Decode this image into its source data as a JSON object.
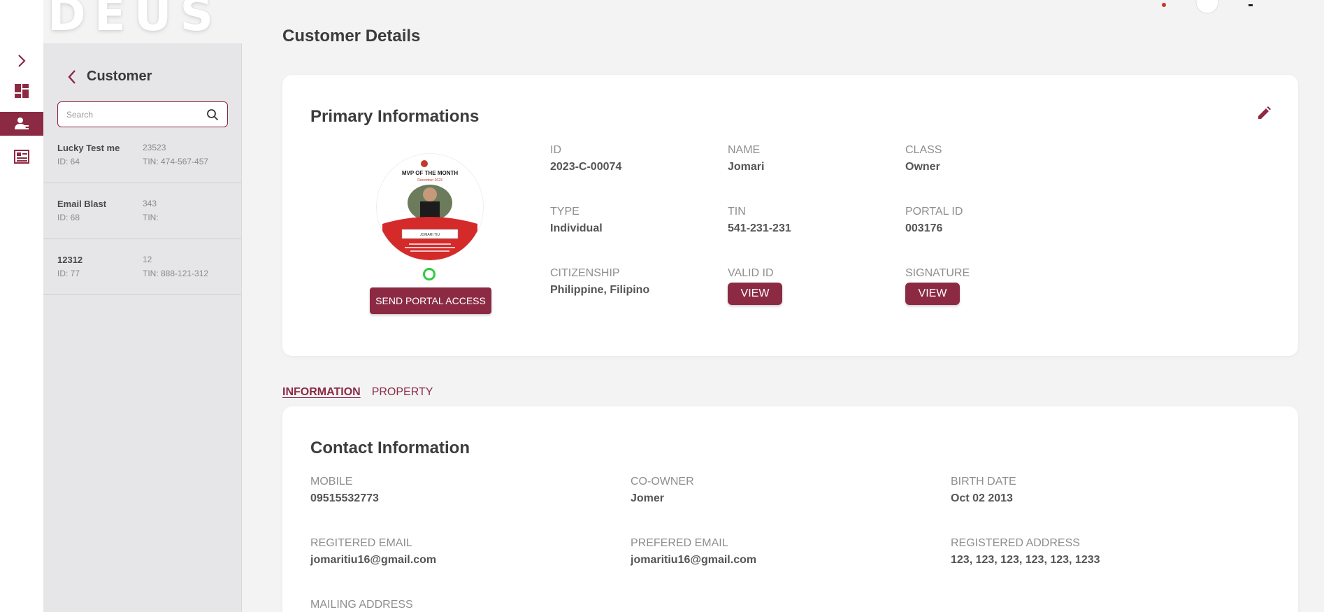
{
  "brand": {
    "text": "DEUS"
  },
  "colors": {
    "accent": "#8c2a44",
    "online": "#2ecc40",
    "background": "#f3f3f4",
    "panel": "#e6e6e8"
  },
  "rail": {
    "items": [
      {
        "icon": "chevron-right-icon"
      },
      {
        "icon": "dashboard-icon"
      },
      {
        "icon": "customers-icon",
        "active": true
      },
      {
        "icon": "ledger-icon"
      }
    ]
  },
  "sidebar": {
    "title": "Customer",
    "search_placeholder": "Search",
    "customers": [
      {
        "name": "Lucky Test me",
        "id": "ID: 64",
        "code": "23523",
        "tin": "TIN: 474-567-457"
      },
      {
        "name": "Email Blast",
        "id": "ID: 68",
        "code": "343",
        "tin": "TIN:"
      },
      {
        "name": "12312",
        "id": "ID: 77",
        "code": "12",
        "tin": "TIN: 888-121-312"
      }
    ]
  },
  "page": {
    "title": "Customer Details"
  },
  "primary": {
    "title": "Primary Informations",
    "avatar": {
      "badge_title": "MVP OF THE MONTH",
      "badge_subtitle": "December 2023",
      "badge_name": "JOMARI TIU"
    },
    "send_portal_label": "SEND PORTAL ACCESS",
    "fields": {
      "id": {
        "label": "ID",
        "value": "2023-C-00074"
      },
      "name": {
        "label": "NAME",
        "value": "Jomari"
      },
      "class": {
        "label": "CLASS",
        "value": "Owner"
      },
      "type": {
        "label": "TYPE",
        "value": "Individual"
      },
      "tin": {
        "label": "TIN",
        "value": "541-231-231"
      },
      "portal_id": {
        "label": "PORTAL ID",
        "value": "003176"
      },
      "citizenship": {
        "label": "CITIZENSHIP",
        "value": "Philippine, Filipino"
      },
      "valid_id": {
        "label": "VALID ID",
        "button": "VIEW"
      },
      "signature": {
        "label": "SIGNATURE",
        "button": "VIEW"
      }
    }
  },
  "tabs": [
    {
      "label": "INFORMATION",
      "active": true
    },
    {
      "label": "PROPERTY",
      "active": false
    }
  ],
  "contact": {
    "title": "Contact Information",
    "fields": {
      "mobile": {
        "label": "MOBILE",
        "value": "09515532773"
      },
      "co_owner": {
        "label": "CO-OWNER",
        "value": "Jomer"
      },
      "birth_date": {
        "label": "BIRTH DATE",
        "value": "Oct 02 2013"
      },
      "registered_email": {
        "label": "REGITERED EMAIL",
        "value": "jomaritiu16@gmail.com"
      },
      "preferred_email": {
        "label": "PREFERED EMAIL",
        "value": "jomaritiu16@gmail.com"
      },
      "registered_address": {
        "label": "REGISTERED ADDRESS",
        "value": "123, 123, 123, 123, 123, 1233"
      },
      "mailing_address": {
        "label": "MAILING ADDRESS"
      }
    }
  }
}
